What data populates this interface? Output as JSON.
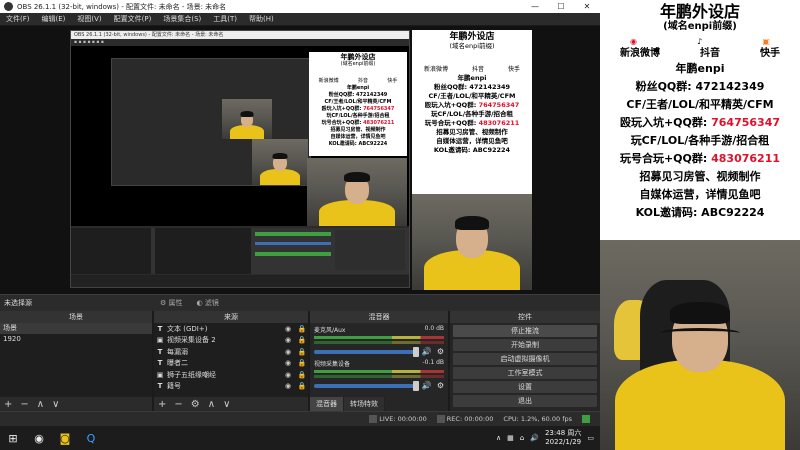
{
  "window": {
    "title": "OBS 26.1.1 (32-bit, windows) - 配置文件: 未命名 - 场景: 未命名",
    "min": "—",
    "max": "☐",
    "close": "✕"
  },
  "menu": [
    "文件(F)",
    "编辑(E)",
    "视图(V)",
    "配置文件(P)",
    "场景集合(S)",
    "工具(T)",
    "帮助(H)"
  ],
  "nested_title": "OBS 26.1.1 (32-bit, windows) - 配置文件: 未命名 - 场景: 未命名",
  "dock_status": {
    "no_selection": "未选择源",
    "properties": "属性",
    "filters": "滤镜"
  },
  "scenes": {
    "header": "场景",
    "items": [
      "场景",
      "1920"
    ],
    "selected": 0
  },
  "sources": {
    "header": "来源",
    "items": [
      {
        "icon": "T",
        "label": "文本 (GDI+)"
      },
      {
        "icon": "▣",
        "label": "视频采集设备 2"
      },
      {
        "icon": "T",
        "label": "每漏溺"
      },
      {
        "icon": "T",
        "label": "曝者二"
      },
      {
        "icon": "▣",
        "label": "狮子五纸缘嘲经"
      },
      {
        "icon": "T",
        "label": "籍号"
      }
    ]
  },
  "mixer": {
    "header": "混音器",
    "channels": [
      {
        "name": "麦克风/Aux",
        "db": "0.0 dB"
      },
      {
        "name": "视频采集设备",
        "db": "-0.1 dB"
      }
    ],
    "tabs": [
      "混音器",
      "转场特效"
    ]
  },
  "controls": {
    "header": "控件",
    "buttons": [
      "停止推流",
      "开始录制",
      "启动虚拟摄像机",
      "工作室模式",
      "设置",
      "退出"
    ]
  },
  "status": {
    "live": "LIVE: 00:00:00",
    "rec": "REC: 00:00:00",
    "cpu": "CPU: 1.2%, 60.00 fps"
  },
  "taskbar": {
    "time": "23:48 周六",
    "date": "2022/1/29"
  },
  "promo": {
    "title": "年鹏外设店",
    "subtitle": "(域名enpi前缀)",
    "platforms": [
      "新浪微博",
      "抖音",
      "快手"
    ],
    "brand": "年鹏enpi",
    "fans_qq": "粉丝QQ群: 472142349",
    "line1": "CF/王者/LOL/和平精英/CFM",
    "line2_prefix": "殴玩入坑+QQ群: ",
    "line2_num": "764756347",
    "line3": "玩CF/LOL/各种手游/招合租",
    "line4_prefix": "玩号合玩+QQ群: ",
    "line4_num": "483076211",
    "line5": "招募见习房管、视频制作",
    "line6": "自媒体运营，详情见鱼吧",
    "kol": "KOL邀请码: ABC92224"
  },
  "colors": {
    "accent_red": "#e0102a",
    "person_yellow": "#e9c31a",
    "obs_bg": "#2b2b2b"
  }
}
